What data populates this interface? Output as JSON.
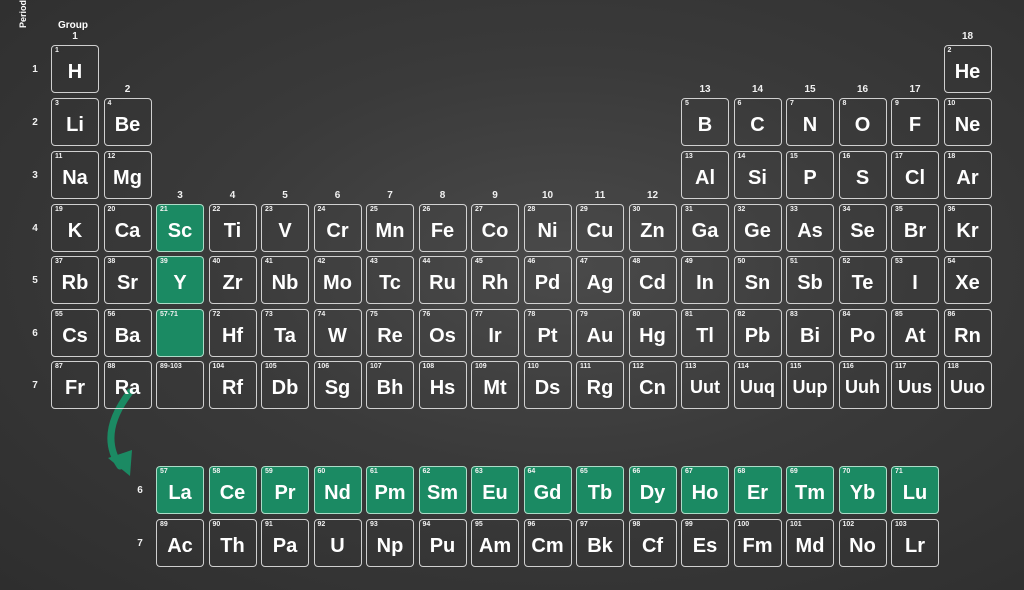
{
  "labels": {
    "group_title": "Group",
    "period_title": "Period",
    "groups": [
      "1",
      "2",
      "3",
      "4",
      "5",
      "6",
      "7",
      "8",
      "9",
      "10",
      "11",
      "12",
      "13",
      "14",
      "15",
      "16",
      "17",
      "18"
    ],
    "periods": [
      "1",
      "2",
      "3",
      "4",
      "5",
      "6",
      "7"
    ],
    "fblock_periods": [
      "6",
      "7"
    ]
  },
  "colors": {
    "highlight": "#1b8a63",
    "board": "#3a3a3a",
    "chalk": "#f2f2f2"
  },
  "elements": [
    {
      "n": "1",
      "s": "H",
      "r": 1,
      "c": 1
    },
    {
      "n": "2",
      "s": "He",
      "r": 1,
      "c": 18
    },
    {
      "n": "3",
      "s": "Li",
      "r": 2,
      "c": 1
    },
    {
      "n": "4",
      "s": "Be",
      "r": 2,
      "c": 2
    },
    {
      "n": "5",
      "s": "B",
      "r": 2,
      "c": 13
    },
    {
      "n": "6",
      "s": "C",
      "r": 2,
      "c": 14
    },
    {
      "n": "7",
      "s": "N",
      "r": 2,
      "c": 15
    },
    {
      "n": "8",
      "s": "O",
      "r": 2,
      "c": 16
    },
    {
      "n": "9",
      "s": "F",
      "r": 2,
      "c": 17
    },
    {
      "n": "10",
      "s": "Ne",
      "r": 2,
      "c": 18
    },
    {
      "n": "11",
      "s": "Na",
      "r": 3,
      "c": 1
    },
    {
      "n": "12",
      "s": "Mg",
      "r": 3,
      "c": 2
    },
    {
      "n": "13",
      "s": "Al",
      "r": 3,
      "c": 13
    },
    {
      "n": "14",
      "s": "Si",
      "r": 3,
      "c": 14
    },
    {
      "n": "15",
      "s": "P",
      "r": 3,
      "c": 15
    },
    {
      "n": "16",
      "s": "S",
      "r": 3,
      "c": 16
    },
    {
      "n": "17",
      "s": "Cl",
      "r": 3,
      "c": 17
    },
    {
      "n": "18",
      "s": "Ar",
      "r": 3,
      "c": 18
    },
    {
      "n": "19",
      "s": "K",
      "r": 4,
      "c": 1
    },
    {
      "n": "20",
      "s": "Ca",
      "r": 4,
      "c": 2
    },
    {
      "n": "21",
      "s": "Sc",
      "r": 4,
      "c": 3,
      "h": true
    },
    {
      "n": "22",
      "s": "Ti",
      "r": 4,
      "c": 4
    },
    {
      "n": "23",
      "s": "V",
      "r": 4,
      "c": 5
    },
    {
      "n": "24",
      "s": "Cr",
      "r": 4,
      "c": 6
    },
    {
      "n": "25",
      "s": "Mn",
      "r": 4,
      "c": 7
    },
    {
      "n": "26",
      "s": "Fe",
      "r": 4,
      "c": 8
    },
    {
      "n": "27",
      "s": "Co",
      "r": 4,
      "c": 9
    },
    {
      "n": "28",
      "s": "Ni",
      "r": 4,
      "c": 10
    },
    {
      "n": "29",
      "s": "Cu",
      "r": 4,
      "c": 11
    },
    {
      "n": "30",
      "s": "Zn",
      "r": 4,
      "c": 12
    },
    {
      "n": "31",
      "s": "Ga",
      "r": 4,
      "c": 13
    },
    {
      "n": "32",
      "s": "Ge",
      "r": 4,
      "c": 14
    },
    {
      "n": "33",
      "s": "As",
      "r": 4,
      "c": 15
    },
    {
      "n": "34",
      "s": "Se",
      "r": 4,
      "c": 16
    },
    {
      "n": "35",
      "s": "Br",
      "r": 4,
      "c": 17
    },
    {
      "n": "36",
      "s": "Kr",
      "r": 4,
      "c": 18
    },
    {
      "n": "37",
      "s": "Rb",
      "r": 5,
      "c": 1
    },
    {
      "n": "38",
      "s": "Sr",
      "r": 5,
      "c": 2
    },
    {
      "n": "39",
      "s": "Y",
      "r": 5,
      "c": 3,
      "h": true
    },
    {
      "n": "40",
      "s": "Zr",
      "r": 5,
      "c": 4
    },
    {
      "n": "41",
      "s": "Nb",
      "r": 5,
      "c": 5
    },
    {
      "n": "42",
      "s": "Mo",
      "r": 5,
      "c": 6
    },
    {
      "n": "43",
      "s": "Tc",
      "r": 5,
      "c": 7
    },
    {
      "n": "44",
      "s": "Ru",
      "r": 5,
      "c": 8
    },
    {
      "n": "45",
      "s": "Rh",
      "r": 5,
      "c": 9
    },
    {
      "n": "46",
      "s": "Pd",
      "r": 5,
      "c": 10
    },
    {
      "n": "47",
      "s": "Ag",
      "r": 5,
      "c": 11
    },
    {
      "n": "48",
      "s": "Cd",
      "r": 5,
      "c": 12
    },
    {
      "n": "49",
      "s": "In",
      "r": 5,
      "c": 13
    },
    {
      "n": "50",
      "s": "Sn",
      "r": 5,
      "c": 14
    },
    {
      "n": "51",
      "s": "Sb",
      "r": 5,
      "c": 15
    },
    {
      "n": "52",
      "s": "Te",
      "r": 5,
      "c": 16
    },
    {
      "n": "53",
      "s": "I",
      "r": 5,
      "c": 17
    },
    {
      "n": "54",
      "s": "Xe",
      "r": 5,
      "c": 18
    },
    {
      "n": "55",
      "s": "Cs",
      "r": 6,
      "c": 1
    },
    {
      "n": "56",
      "s": "Ba",
      "r": 6,
      "c": 2
    },
    {
      "n": "57-71",
      "s": "",
      "r": 6,
      "c": 3,
      "h": true
    },
    {
      "n": "72",
      "s": "Hf",
      "r": 6,
      "c": 4
    },
    {
      "n": "73",
      "s": "Ta",
      "r": 6,
      "c": 5
    },
    {
      "n": "74",
      "s": "W",
      "r": 6,
      "c": 6
    },
    {
      "n": "75",
      "s": "Re",
      "r": 6,
      "c": 7
    },
    {
      "n": "76",
      "s": "Os",
      "r": 6,
      "c": 8
    },
    {
      "n": "77",
      "s": "Ir",
      "r": 6,
      "c": 9
    },
    {
      "n": "78",
      "s": "Pt",
      "r": 6,
      "c": 10
    },
    {
      "n": "79",
      "s": "Au",
      "r": 6,
      "c": 11
    },
    {
      "n": "80",
      "s": "Hg",
      "r": 6,
      "c": 12
    },
    {
      "n": "81",
      "s": "Tl",
      "r": 6,
      "c": 13
    },
    {
      "n": "82",
      "s": "Pb",
      "r": 6,
      "c": 14
    },
    {
      "n": "83",
      "s": "Bi",
      "r": 6,
      "c": 15
    },
    {
      "n": "84",
      "s": "Po",
      "r": 6,
      "c": 16
    },
    {
      "n": "85",
      "s": "At",
      "r": 6,
      "c": 17
    },
    {
      "n": "86",
      "s": "Rn",
      "r": 6,
      "c": 18
    },
    {
      "n": "87",
      "s": "Fr",
      "r": 7,
      "c": 1
    },
    {
      "n": "88",
      "s": "Ra",
      "r": 7,
      "c": 2
    },
    {
      "n": "89-103",
      "s": "",
      "r": 7,
      "c": 3
    },
    {
      "n": "104",
      "s": "Rf",
      "r": 7,
      "c": 4
    },
    {
      "n": "105",
      "s": "Db",
      "r": 7,
      "c": 5
    },
    {
      "n": "106",
      "s": "Sg",
      "r": 7,
      "c": 6
    },
    {
      "n": "107",
      "s": "Bh",
      "r": 7,
      "c": 7
    },
    {
      "n": "108",
      "s": "Hs",
      "r": 7,
      "c": 8
    },
    {
      "n": "109",
      "s": "Mt",
      "r": 7,
      "c": 9
    },
    {
      "n": "110",
      "s": "Ds",
      "r": 7,
      "c": 10
    },
    {
      "n": "111",
      "s": "Rg",
      "r": 7,
      "c": 11
    },
    {
      "n": "112",
      "s": "Cn",
      "r": 7,
      "c": 12
    },
    {
      "n": "113",
      "s": "Uut",
      "r": 7,
      "c": 13
    },
    {
      "n": "114",
      "s": "Uuq",
      "r": 7,
      "c": 14
    },
    {
      "n": "115",
      "s": "Uup",
      "r": 7,
      "c": 15
    },
    {
      "n": "116",
      "s": "Uuh",
      "r": 7,
      "c": 16
    },
    {
      "n": "117",
      "s": "Uus",
      "r": 7,
      "c": 17
    },
    {
      "n": "118",
      "s": "Uuo",
      "r": 7,
      "c": 18
    },
    {
      "n": "57",
      "s": "La",
      "r": 9,
      "c": 3,
      "h": true
    },
    {
      "n": "58",
      "s": "Ce",
      "r": 9,
      "c": 4,
      "h": true
    },
    {
      "n": "59",
      "s": "Pr",
      "r": 9,
      "c": 5,
      "h": true
    },
    {
      "n": "60",
      "s": "Nd",
      "r": 9,
      "c": 6,
      "h": true
    },
    {
      "n": "61",
      "s": "Pm",
      "r": 9,
      "c": 7,
      "h": true
    },
    {
      "n": "62",
      "s": "Sm",
      "r": 9,
      "c": 8,
      "h": true
    },
    {
      "n": "63",
      "s": "Eu",
      "r": 9,
      "c": 9,
      "h": true
    },
    {
      "n": "64",
      "s": "Gd",
      "r": 9,
      "c": 10,
      "h": true
    },
    {
      "n": "65",
      "s": "Tb",
      "r": 9,
      "c": 11,
      "h": true
    },
    {
      "n": "66",
      "s": "Dy",
      "r": 9,
      "c": 12,
      "h": true
    },
    {
      "n": "67",
      "s": "Ho",
      "r": 9,
      "c": 13,
      "h": true
    },
    {
      "n": "68",
      "s": "Er",
      "r": 9,
      "c": 14,
      "h": true
    },
    {
      "n": "69",
      "s": "Tm",
      "r": 9,
      "c": 15,
      "h": true
    },
    {
      "n": "70",
      "s": "Yb",
      "r": 9,
      "c": 16,
      "h": true
    },
    {
      "n": "71",
      "s": "Lu",
      "r": 9,
      "c": 17,
      "h": true
    },
    {
      "n": "89",
      "s": "Ac",
      "r": 10,
      "c": 3
    },
    {
      "n": "90",
      "s": "Th",
      "r": 10,
      "c": 4
    },
    {
      "n": "91",
      "s": "Pa",
      "r": 10,
      "c": 5
    },
    {
      "n": "92",
      "s": "U",
      "r": 10,
      "c": 6
    },
    {
      "n": "93",
      "s": "Np",
      "r": 10,
      "c": 7
    },
    {
      "n": "94",
      "s": "Pu",
      "r": 10,
      "c": 8
    },
    {
      "n": "95",
      "s": "Am",
      "r": 10,
      "c": 9
    },
    {
      "n": "96",
      "s": "Cm",
      "r": 10,
      "c": 10
    },
    {
      "n": "97",
      "s": "Bk",
      "r": 10,
      "c": 11
    },
    {
      "n": "98",
      "s": "Cf",
      "r": 10,
      "c": 12
    },
    {
      "n": "99",
      "s": "Es",
      "r": 10,
      "c": 13
    },
    {
      "n": "100",
      "s": "Fm",
      "r": 10,
      "c": 14
    },
    {
      "n": "101",
      "s": "Md",
      "r": 10,
      "c": 15
    },
    {
      "n": "102",
      "s": "No",
      "r": 10,
      "c": 16
    },
    {
      "n": "103",
      "s": "Lr",
      "r": 10,
      "c": 17
    }
  ]
}
